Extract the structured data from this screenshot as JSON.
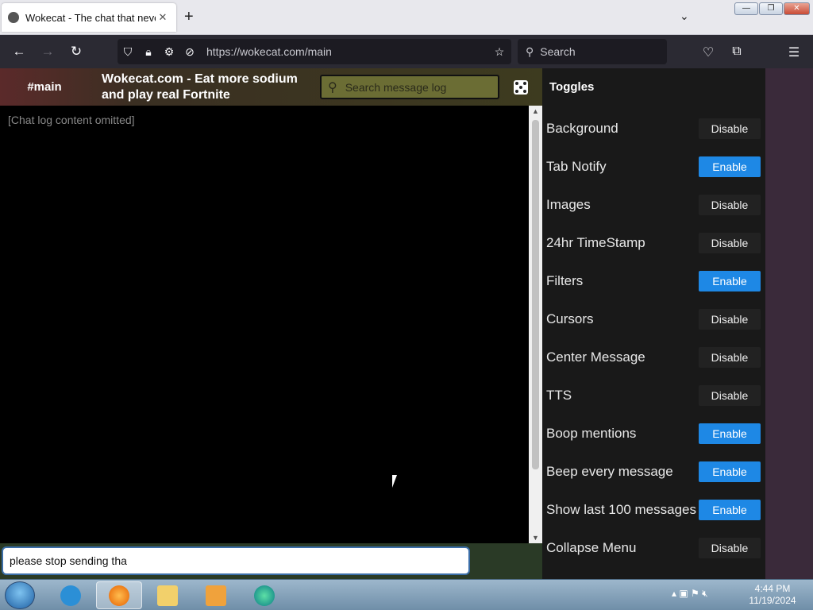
{
  "browser": {
    "tab_title": "Wokecat - The chat that never",
    "tab_close": "✕",
    "new_tab": "+",
    "list_all": "⌄",
    "window_controls": {
      "minimize": "—",
      "maximize": "❐",
      "close": "✕"
    },
    "url": "https://wokecat.com/main",
    "search_placeholder": "Search",
    "ext_badge": "uB"
  },
  "header": {
    "channel": "#main",
    "title": "Wokecat.com - Eat more sodium and play real Fortnite",
    "search_placeholder": "Search message log"
  },
  "chat": {
    "placeholder": "[Chat log content omitted]"
  },
  "input": {
    "value": "please stop sending tha"
  },
  "panel": {
    "title": "Toggles",
    "toggles": [
      {
        "label": "Background",
        "button": "Disable",
        "state": "disable"
      },
      {
        "label": "Tab Notify",
        "button": "Enable",
        "state": "enable"
      },
      {
        "label": "Images",
        "button": "Disable",
        "state": "disable"
      },
      {
        "label": "24hr TimeStamp",
        "button": "Disable",
        "state": "disable"
      },
      {
        "label": "Filters",
        "button": "Enable",
        "state": "enable"
      },
      {
        "label": "Cursors",
        "button": "Disable",
        "state": "disable"
      },
      {
        "label": "Center Message",
        "button": "Disable",
        "state": "disable"
      },
      {
        "label": "TTS",
        "button": "Disable",
        "state": "disable"
      },
      {
        "label": "Boop mentions",
        "button": "Enable",
        "state": "enable"
      },
      {
        "label": "Beep every message",
        "button": "Enable",
        "state": "enable"
      },
      {
        "label": "Show last 100 messages",
        "button": "Enable",
        "state": "enable"
      },
      {
        "label": "Collapse Menu",
        "button": "Disable",
        "state": "disable"
      }
    ]
  },
  "taskbar": {
    "apps": [
      "internet-explorer",
      "firefox",
      "file-explorer",
      "media-player",
      "edge"
    ],
    "clock_time": "4:44 PM",
    "clock_date": "11/19/2024"
  }
}
